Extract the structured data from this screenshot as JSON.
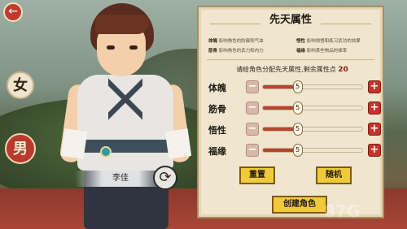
{
  "screen": {
    "back_icon": "←",
    "refresh_icon": "⟳"
  },
  "gender": {
    "female_label": "女",
    "male_label": "男",
    "selected": "男"
  },
  "character": {
    "name": "李佳"
  },
  "panel": {
    "title": "先天属性",
    "legend": [
      {
        "key": "体魄",
        "desc": "影响角色的防御和气血"
      },
      {
        "key": "悟性",
        "desc": "影响领悟和练习武功的效果"
      },
      {
        "key": "筋骨",
        "desc": "影响角色的武力和内力"
      },
      {
        "key": "福缘",
        "desc": "影响某些物品的掉率"
      }
    ],
    "prompt_text": "请给角色分配先天属性,剩余属性点",
    "remaining_points": "20",
    "attributes": [
      {
        "label": "体魄",
        "value": "5",
        "level": 0.35
      },
      {
        "label": "筋骨",
        "value": "5",
        "level": 0.35
      },
      {
        "label": "悟性",
        "value": "5",
        "level": 0.35
      },
      {
        "label": "福缘",
        "value": "5",
        "level": 0.35
      }
    ],
    "minus_label": "−",
    "plus_label": "+",
    "reset_label": "重置",
    "random_label": "随机",
    "create_label": "创建角色"
  },
  "watermark": "87G"
}
